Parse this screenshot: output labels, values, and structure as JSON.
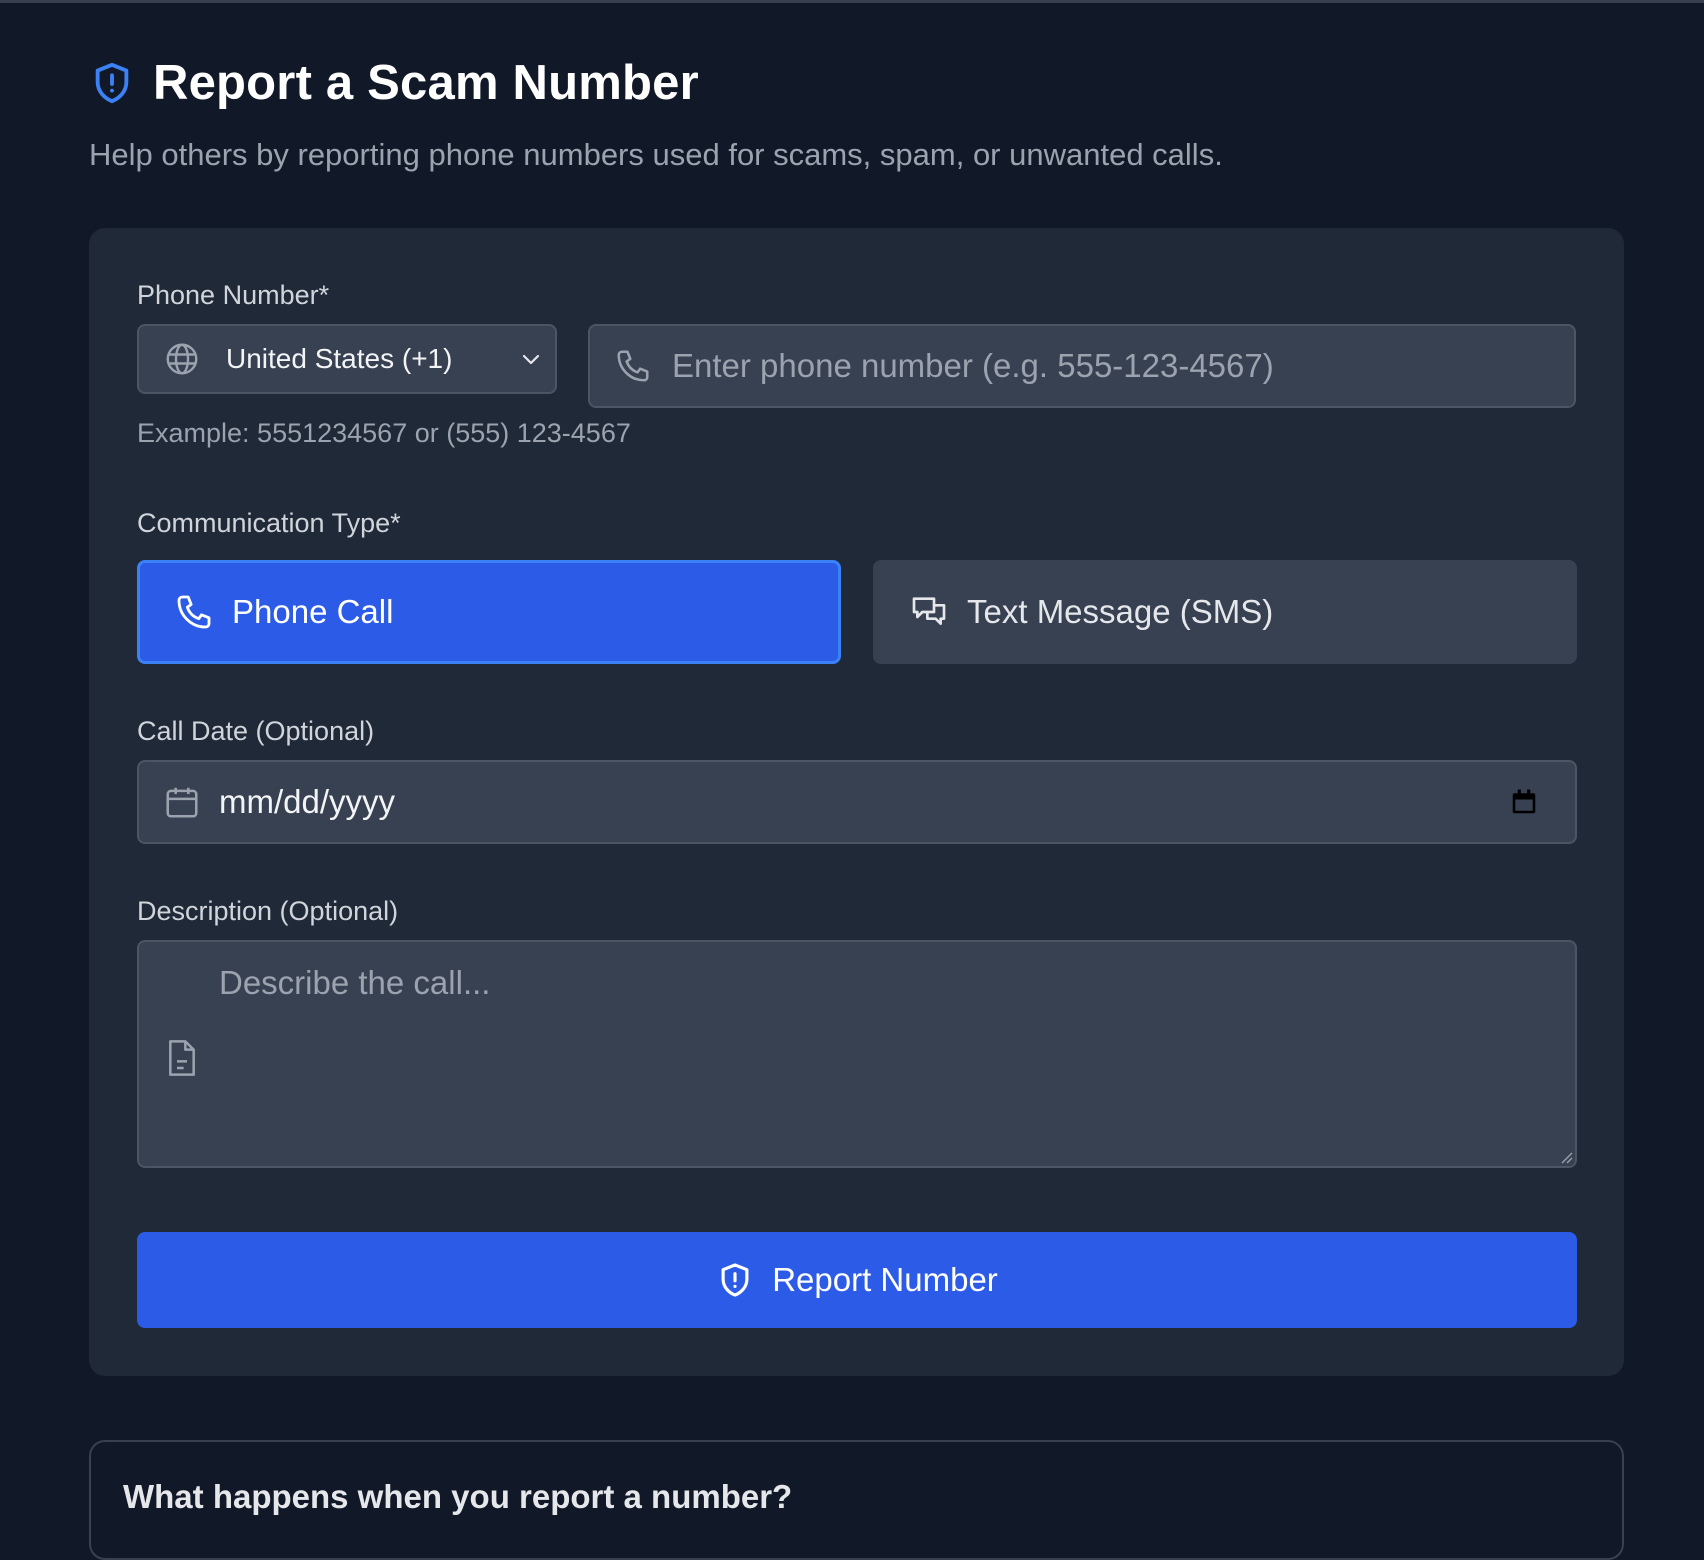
{
  "header": {
    "title": "Report a Scam Number",
    "subtitle": "Help others by reporting phone numbers used for scams, spam, or unwanted calls.",
    "icon": "shield-alert-icon"
  },
  "form": {
    "phone": {
      "label": "Phone Number*",
      "country_value": "United States (+1)",
      "placeholder": "Enter phone number (e.g. 555-123-4567)",
      "hint": "Example: 5551234567 or (555) 123-4567"
    },
    "type": {
      "label": "Communication Type*",
      "options": [
        {
          "label": "Phone Call",
          "icon": "phone-icon",
          "selected": true
        },
        {
          "label": "Text Message (SMS)",
          "icon": "message-icon",
          "selected": false
        }
      ]
    },
    "date": {
      "label": "Call Date (Optional)",
      "value": "mm/dd/yyyy"
    },
    "description": {
      "label": "Description (Optional)",
      "placeholder": "Describe the call..."
    },
    "submit_label": "Report Number"
  },
  "next_section": {
    "title": "What happens when you report a number?"
  },
  "colors": {
    "background": "#111827",
    "card": "#1f2937",
    "input": "#374151",
    "accent": "#2c5be8",
    "accent_icon": "#3b82f6"
  }
}
